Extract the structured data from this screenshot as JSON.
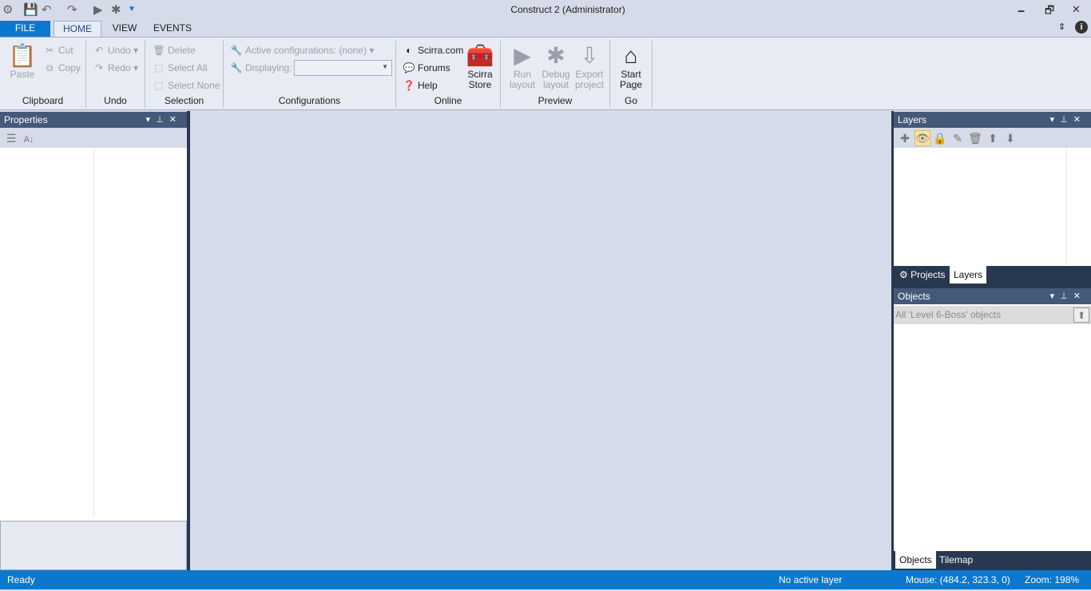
{
  "window": {
    "title": "Construct 2 (Administrator)",
    "minimize": "🗕",
    "restore": "🗗",
    "close": "✕"
  },
  "menu": {
    "tabs": [
      "FILE",
      "HOME",
      "VIEW",
      "EVENTS"
    ]
  },
  "ribbon": {
    "clipboard": {
      "label": "Clipboard",
      "paste": "Paste",
      "cut": "Cut",
      "copy": "Copy"
    },
    "undo": {
      "label": "Undo",
      "undo": "Undo",
      "redo": "Redo"
    },
    "selection": {
      "label": "Selection",
      "delete": "Delete",
      "select_all": "Select All",
      "select_none": "Select None"
    },
    "configurations": {
      "label": "Configurations",
      "active": "Active configurations: (none)",
      "displaying": "Displaying:",
      "displaying_value": ""
    },
    "online": {
      "label": "Online",
      "scirra": "Scirra.com",
      "forums": "Forums",
      "help": "Help",
      "store_line1": "Scirra",
      "store_line2": "Store"
    },
    "preview": {
      "label": "Preview",
      "run1": "Run",
      "run2": "layout",
      "debug1": "Debug",
      "debug2": "layout",
      "export1": "Export",
      "export2": "project"
    },
    "go": {
      "label": "Go",
      "start1": "Start",
      "start2": "Page"
    }
  },
  "properties": {
    "title": "Properties"
  },
  "layers": {
    "title": "Layers",
    "tabs": [
      "Projects",
      "Layers"
    ]
  },
  "objects": {
    "title": "Objects",
    "filter": "All 'Level 6-Boss' objects",
    "tabs": [
      "Objects",
      "Tilemap"
    ]
  },
  "status": {
    "left": "Ready",
    "layer": "No active layer",
    "mouse": "Mouse: (484.2, 323.3, 0)",
    "zoom": "Zoom: 198%"
  }
}
